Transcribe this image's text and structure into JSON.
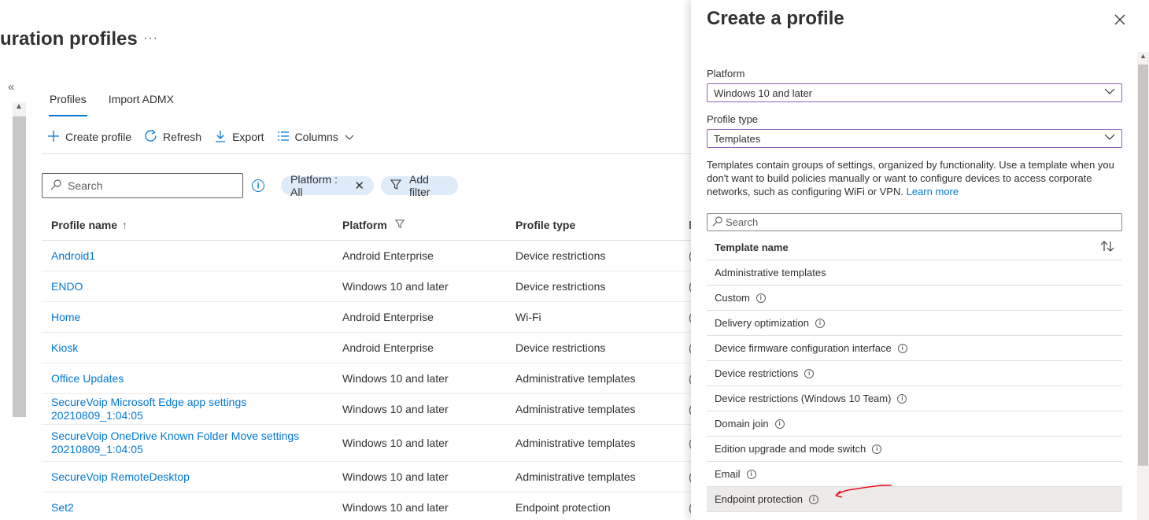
{
  "page": {
    "title": "uration profiles",
    "more": "···",
    "collapse": "«"
  },
  "tabs": [
    {
      "label": "Profiles",
      "active": true
    },
    {
      "label": "Import ADMX",
      "active": false
    }
  ],
  "toolbar": {
    "create": {
      "icon": "plus-icon",
      "label": "Create profile"
    },
    "refresh": {
      "icon": "refresh-icon",
      "label": "Refresh"
    },
    "export": {
      "icon": "download-icon",
      "label": "Export"
    },
    "columns": {
      "icon": "columns-icon",
      "label": "Columns"
    }
  },
  "filter": {
    "search_placeholder": "Search",
    "platform_pill": "Platform : All",
    "add_filter": "Add filter"
  },
  "grid": {
    "headers": {
      "name": "Profile name",
      "platform": "Platform",
      "type": "Profile type"
    },
    "rows": [
      {
        "name": "Android1",
        "platform": "Android Enterprise",
        "type": "Device restrictions",
        "extra": "("
      },
      {
        "name": "ENDO",
        "platform": "Windows 10 and later",
        "type": "Device restrictions",
        "extra": "("
      },
      {
        "name": "Home",
        "platform": "Android Enterprise",
        "type": "Wi-Fi",
        "extra": "("
      },
      {
        "name": "Kiosk",
        "platform": "Android Enterprise",
        "type": "Device restrictions",
        "extra": "("
      },
      {
        "name": "Office Updates",
        "platform": "Windows 10 and later",
        "type": "Administrative templates",
        "extra": "("
      },
      {
        "name": "SecureVoip Microsoft Edge app settings 20210809_1:04:05",
        "platform": "Windows 10 and later",
        "type": "Administrative templates",
        "extra": "("
      },
      {
        "name": "SecureVoip OneDrive Known Folder Move settings 20210809_1:04:05",
        "platform": "Windows 10 and later",
        "type": "Administrative templates",
        "extra": "("
      },
      {
        "name": "SecureVoip RemoteDesktop",
        "platform": "Windows 10 and later",
        "type": "Administrative templates",
        "extra": "("
      },
      {
        "name": "Set2",
        "platform": "Windows 10 and later",
        "type": "Endpoint protection",
        "extra": "("
      }
    ]
  },
  "panel": {
    "title": "Create a profile",
    "platform_label": "Platform",
    "platform_value": "Windows 10 and later",
    "profile_type_label": "Profile type",
    "profile_type_value": "Templates",
    "description": "Templates contain groups of settings, organized by functionality. Use a template when you don't want to build policies manually or want to configure devices to access corporate networks, such as configuring WiFi or VPN.",
    "learn_more": "Learn more",
    "search_placeholder": "Search",
    "template_header": "Template name",
    "templates": [
      {
        "name": "Administrative templates",
        "info": false,
        "selected": false
      },
      {
        "name": "Custom",
        "info": true,
        "selected": false
      },
      {
        "name": "Delivery optimization",
        "info": true,
        "selected": false
      },
      {
        "name": "Device firmware configuration interface",
        "info": true,
        "selected": false
      },
      {
        "name": "Device restrictions",
        "info": true,
        "selected": false
      },
      {
        "name": "Device restrictions (Windows 10 Team)",
        "info": true,
        "selected": false
      },
      {
        "name": "Domain join",
        "info": true,
        "selected": false
      },
      {
        "name": "Edition upgrade and mode switch",
        "info": true,
        "selected": false
      },
      {
        "name": "Email",
        "info": true,
        "selected": false
      },
      {
        "name": "Endpoint protection",
        "info": true,
        "selected": true
      }
    ]
  },
  "colors": {
    "accent": "#0078d4",
    "dropdown_border": "#8764b8",
    "annotation": "#e81123"
  }
}
